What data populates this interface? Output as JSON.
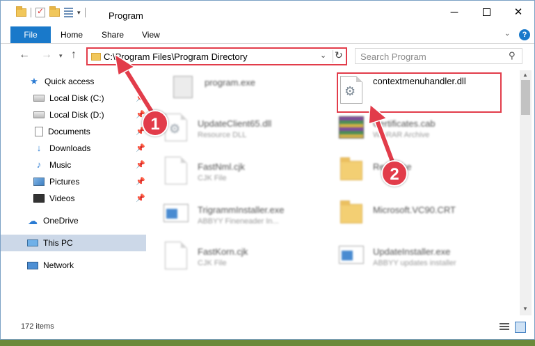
{
  "window": {
    "title": "Program"
  },
  "ribbon": {
    "tabs": [
      {
        "label": "File"
      },
      {
        "label": "Home"
      },
      {
        "label": "Share"
      },
      {
        "label": "View"
      }
    ],
    "help": "?"
  },
  "navbar": {
    "address": "C:\\Program Files\\Program Directory",
    "search_placeholder": "Search Program"
  },
  "sidebar": {
    "items": [
      {
        "label": "Quick access",
        "icon": "star-icon"
      },
      {
        "label": "Local Disk (C:)",
        "icon": "disk-icon"
      },
      {
        "label": "Local Disk (D:)",
        "icon": "disk-icon"
      },
      {
        "label": "Documents",
        "icon": "document-icon"
      },
      {
        "label": "Downloads",
        "icon": "download-icon"
      },
      {
        "label": "Music",
        "icon": "music-icon"
      },
      {
        "label": "Pictures",
        "icon": "pictures-icon"
      },
      {
        "label": "Videos",
        "icon": "videos-icon"
      },
      {
        "label": "OneDrive",
        "icon": "cloud-icon"
      },
      {
        "label": "This PC",
        "icon": "computer-icon"
      },
      {
        "label": "Network",
        "icon": "network-icon"
      }
    ]
  },
  "files": [
    {
      "name": "program.exe",
      "type": ""
    },
    {
      "name": "contextmenuhandler.dll",
      "type": ""
    },
    {
      "name": "UpdateClient65.dll",
      "type": "Resource DLL"
    },
    {
      "name": "Certificates.cab",
      "type": "WinRAR Archive"
    },
    {
      "name": "FastNml.cjk",
      "type": "CJK File"
    },
    {
      "name": "Resource",
      "type": ""
    },
    {
      "name": "TrigrammInstaller.exe",
      "type": "ABBYY Fineneader In..."
    },
    {
      "name": "Microsoft.VC90.CRT",
      "type": ""
    },
    {
      "name": "FastKorn.cjk",
      "type": "CJK File"
    },
    {
      "name": "UpdateInstaller.exe",
      "type": "ABBYY updates installer"
    }
  ],
  "status": {
    "item_count": "172 items"
  },
  "annotations": {
    "step1": "1",
    "step2": "2",
    "color": "#e23c4a"
  }
}
